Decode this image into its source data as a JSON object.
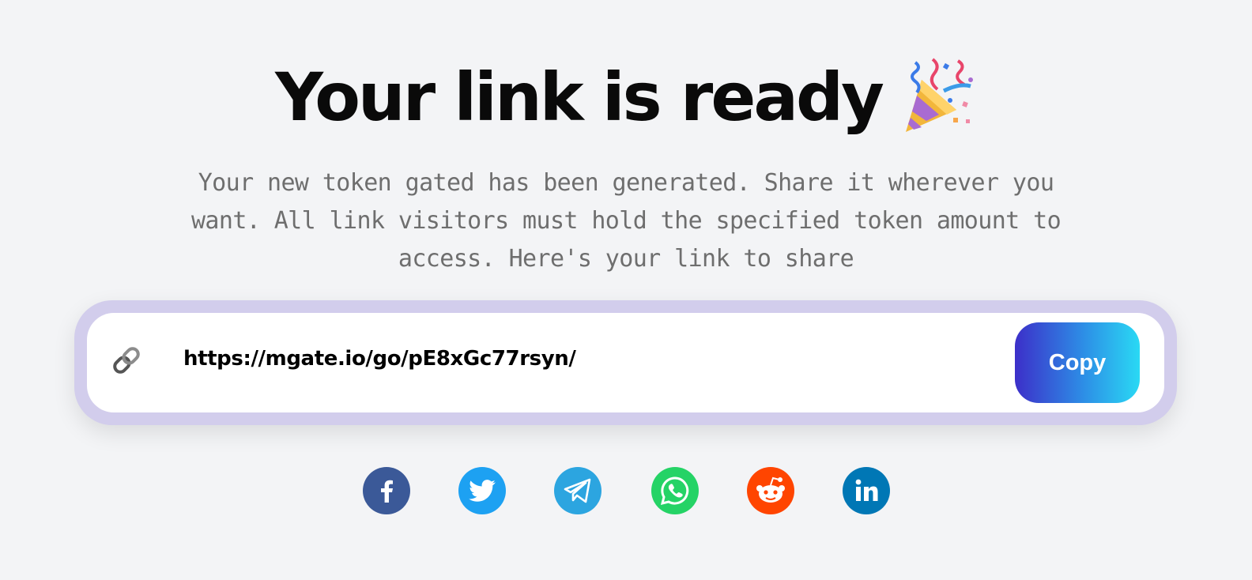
{
  "header": {
    "title": "Your link is ready",
    "title_icon": "party-popper-icon",
    "subtitle": "Your new token gated has been generated. Share it wherever you want. All link visitors must hold the specified token amount to access. Here's your link to share"
  },
  "link_box": {
    "icon": "link-icon",
    "url": "https://mgate.io/go/pE8xGc77rsyn/",
    "copy_label": "Copy",
    "outer_color": "#d2cdec",
    "button_gradient": [
      "#3c2fc9",
      "#2ad9f4"
    ]
  },
  "share": [
    {
      "name": "facebook",
      "icon": "facebook-icon",
      "color": "#3b5998"
    },
    {
      "name": "twitter",
      "icon": "twitter-icon",
      "color": "#1da1f2"
    },
    {
      "name": "telegram",
      "icon": "telegram-icon",
      "color": "#2ca5e0"
    },
    {
      "name": "whatsapp",
      "icon": "whatsapp-icon",
      "color": "#25d366"
    },
    {
      "name": "reddit",
      "icon": "reddit-icon",
      "color": "#ff4500"
    },
    {
      "name": "linkedin",
      "icon": "linkedin-icon",
      "color": "#0077b5"
    }
  ]
}
